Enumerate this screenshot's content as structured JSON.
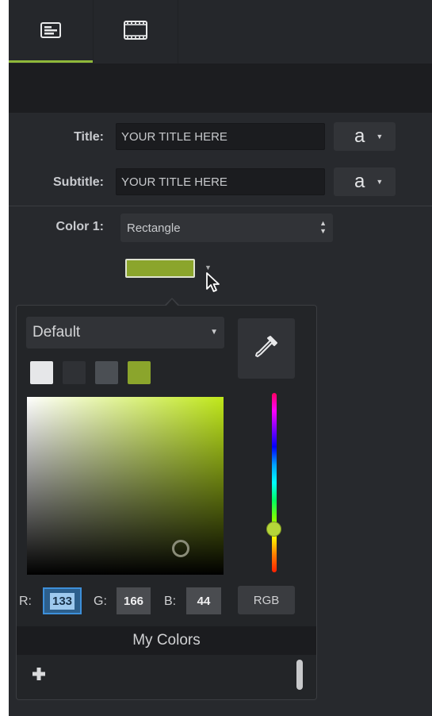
{
  "tabs": [
    {
      "icon": "properties-panel-icon",
      "active": true
    },
    {
      "icon": "film-strip-icon",
      "active": false
    }
  ],
  "fields": {
    "title": {
      "label": "Title:",
      "value": "YOUR TITLE HERE",
      "font_button": "a"
    },
    "subtitle": {
      "label": "Subtitle:",
      "value": "YOUR TITLE HERE",
      "font_button": "a"
    },
    "color1": {
      "label": "Color 1:",
      "value": "Rectangle",
      "swatch_color": "#8ba52c"
    }
  },
  "color_picker": {
    "preset": "Default",
    "swatches": [
      "#e6e7e9",
      "#2f3135",
      "#4b4f54",
      "#8ba52c"
    ],
    "hue_color": "#b5d53a",
    "r_label": "R:",
    "r": "133",
    "g_label": "G:",
    "g": "166",
    "b_label": "B:",
    "b": "44",
    "mode_button": "RGB",
    "my_colors_title": "My Colors"
  },
  "colors": {
    "accent": "#8fb83a",
    "panel_bg": "#27292d",
    "selection": "#3d8fd9"
  }
}
